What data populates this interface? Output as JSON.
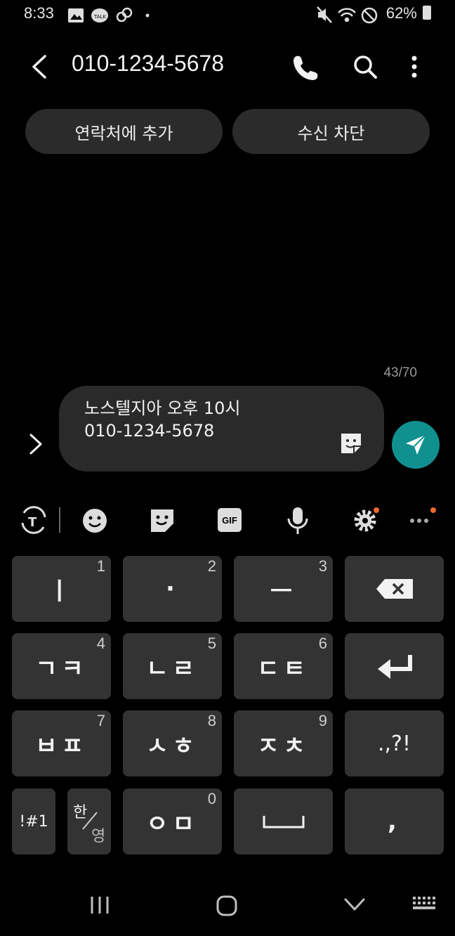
{
  "status_bar": {
    "time": "8:33",
    "battery": "62%",
    "left_icons": [
      "gallery-icon",
      "kakaotalk-icon",
      "link-icon",
      "dot-icon"
    ],
    "right_icons": [
      "mute-icon",
      "wifi-icon",
      "blocked-icon",
      "battery-icon"
    ]
  },
  "header": {
    "title": "010-1234-5678",
    "actions": [
      "call-icon",
      "search-icon",
      "more-icon"
    ]
  },
  "action_buttons": {
    "add_contact": "연락처에 추가",
    "block": "수신 차단"
  },
  "composer": {
    "char_counter": "43/70",
    "message_lines": [
      "노스텔지아 오후 10시",
      "010-1234-5678"
    ],
    "accent_color": "#10908f"
  },
  "keyboard": {
    "toolbar": [
      "translate-icon",
      "emoji-icon",
      "sticker-icon",
      "gif-icon",
      "mic-icon",
      "settings-icon",
      "more-icon"
    ],
    "gif_label": "GIF",
    "keys": [
      {
        "main": "ㅣ",
        "num": "1"
      },
      {
        "main": "·",
        "num": "2"
      },
      {
        "main": "ㅡ",
        "num": "3"
      },
      {
        "main": "ㄱㅋ",
        "num": "4"
      },
      {
        "main": "ㄴㄹ",
        "num": "5"
      },
      {
        "main": "ㄷㅌ",
        "num": "6"
      },
      {
        "main": "ㅂㅍ",
        "num": "7"
      },
      {
        "main": "ㅅㅎ",
        "num": "8"
      },
      {
        "main": "ㅈㅊ",
        "num": "9"
      },
      {
        "main": "ㅇㅁ",
        "num": "0"
      }
    ],
    "punct": ".,?!",
    "symbols": "!#1",
    "lang_top": "한",
    "lang_bottom": "영",
    "comma": ","
  }
}
